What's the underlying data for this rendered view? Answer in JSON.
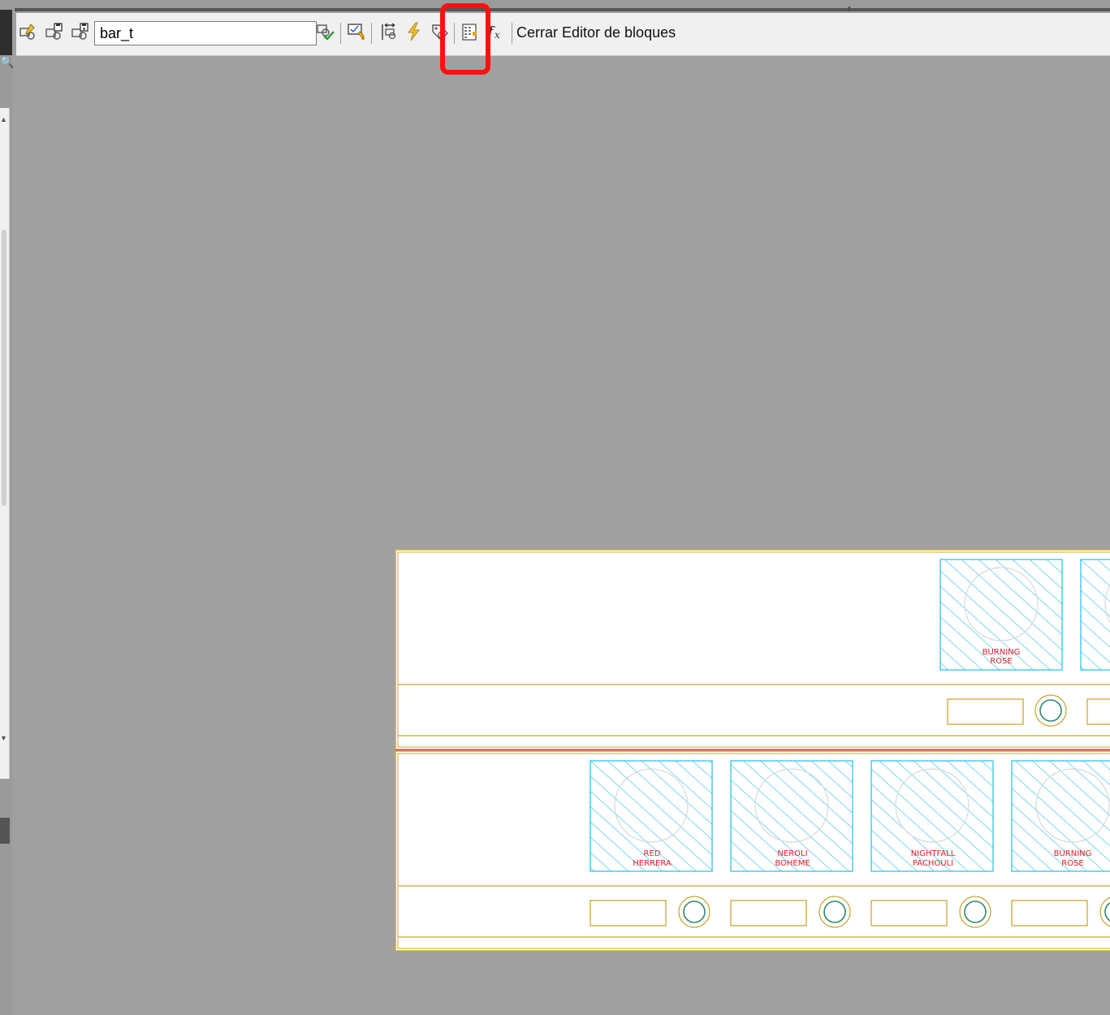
{
  "toolbar": {
    "block_name_value": "bar_t",
    "close_label": "Cerrar Editor de bloques",
    "buttons": [
      {
        "icon": "edit-block-icon"
      },
      {
        "icon": "save-block-icon"
      },
      {
        "icon": "save-block-as-icon"
      },
      {
        "icon": "test-block-icon"
      },
      {
        "icon": "authoring-palettes-icon"
      },
      {
        "icon": "parameter-icon"
      },
      {
        "icon": "action-icon"
      },
      {
        "icon": "attribute-definition-icon"
      },
      {
        "icon": "block-table-icon"
      },
      {
        "icon": "fx-icon"
      }
    ]
  },
  "drawing": {
    "top_row": {
      "tiles": [
        {
          "line1": "BURNING",
          "line2": "ROSE"
        }
      ]
    },
    "bottom_row": {
      "tiles": [
        {
          "line1": "RED",
          "line2": "HERRERA"
        },
        {
          "line1": "NEROLI",
          "line2": "BOHEME"
        },
        {
          "line1": "NIGHTFALL",
          "line2": "PACHOULI"
        },
        {
          "line1": "BURNING",
          "line2": "ROSE"
        }
      ]
    }
  },
  "colors": {
    "cad_yellow": "#c8a832",
    "cad_cyan": "#22bfe8",
    "cad_red": "#e0202a",
    "cad_magenta": "#e8329a",
    "highlight": "#ff1010"
  }
}
